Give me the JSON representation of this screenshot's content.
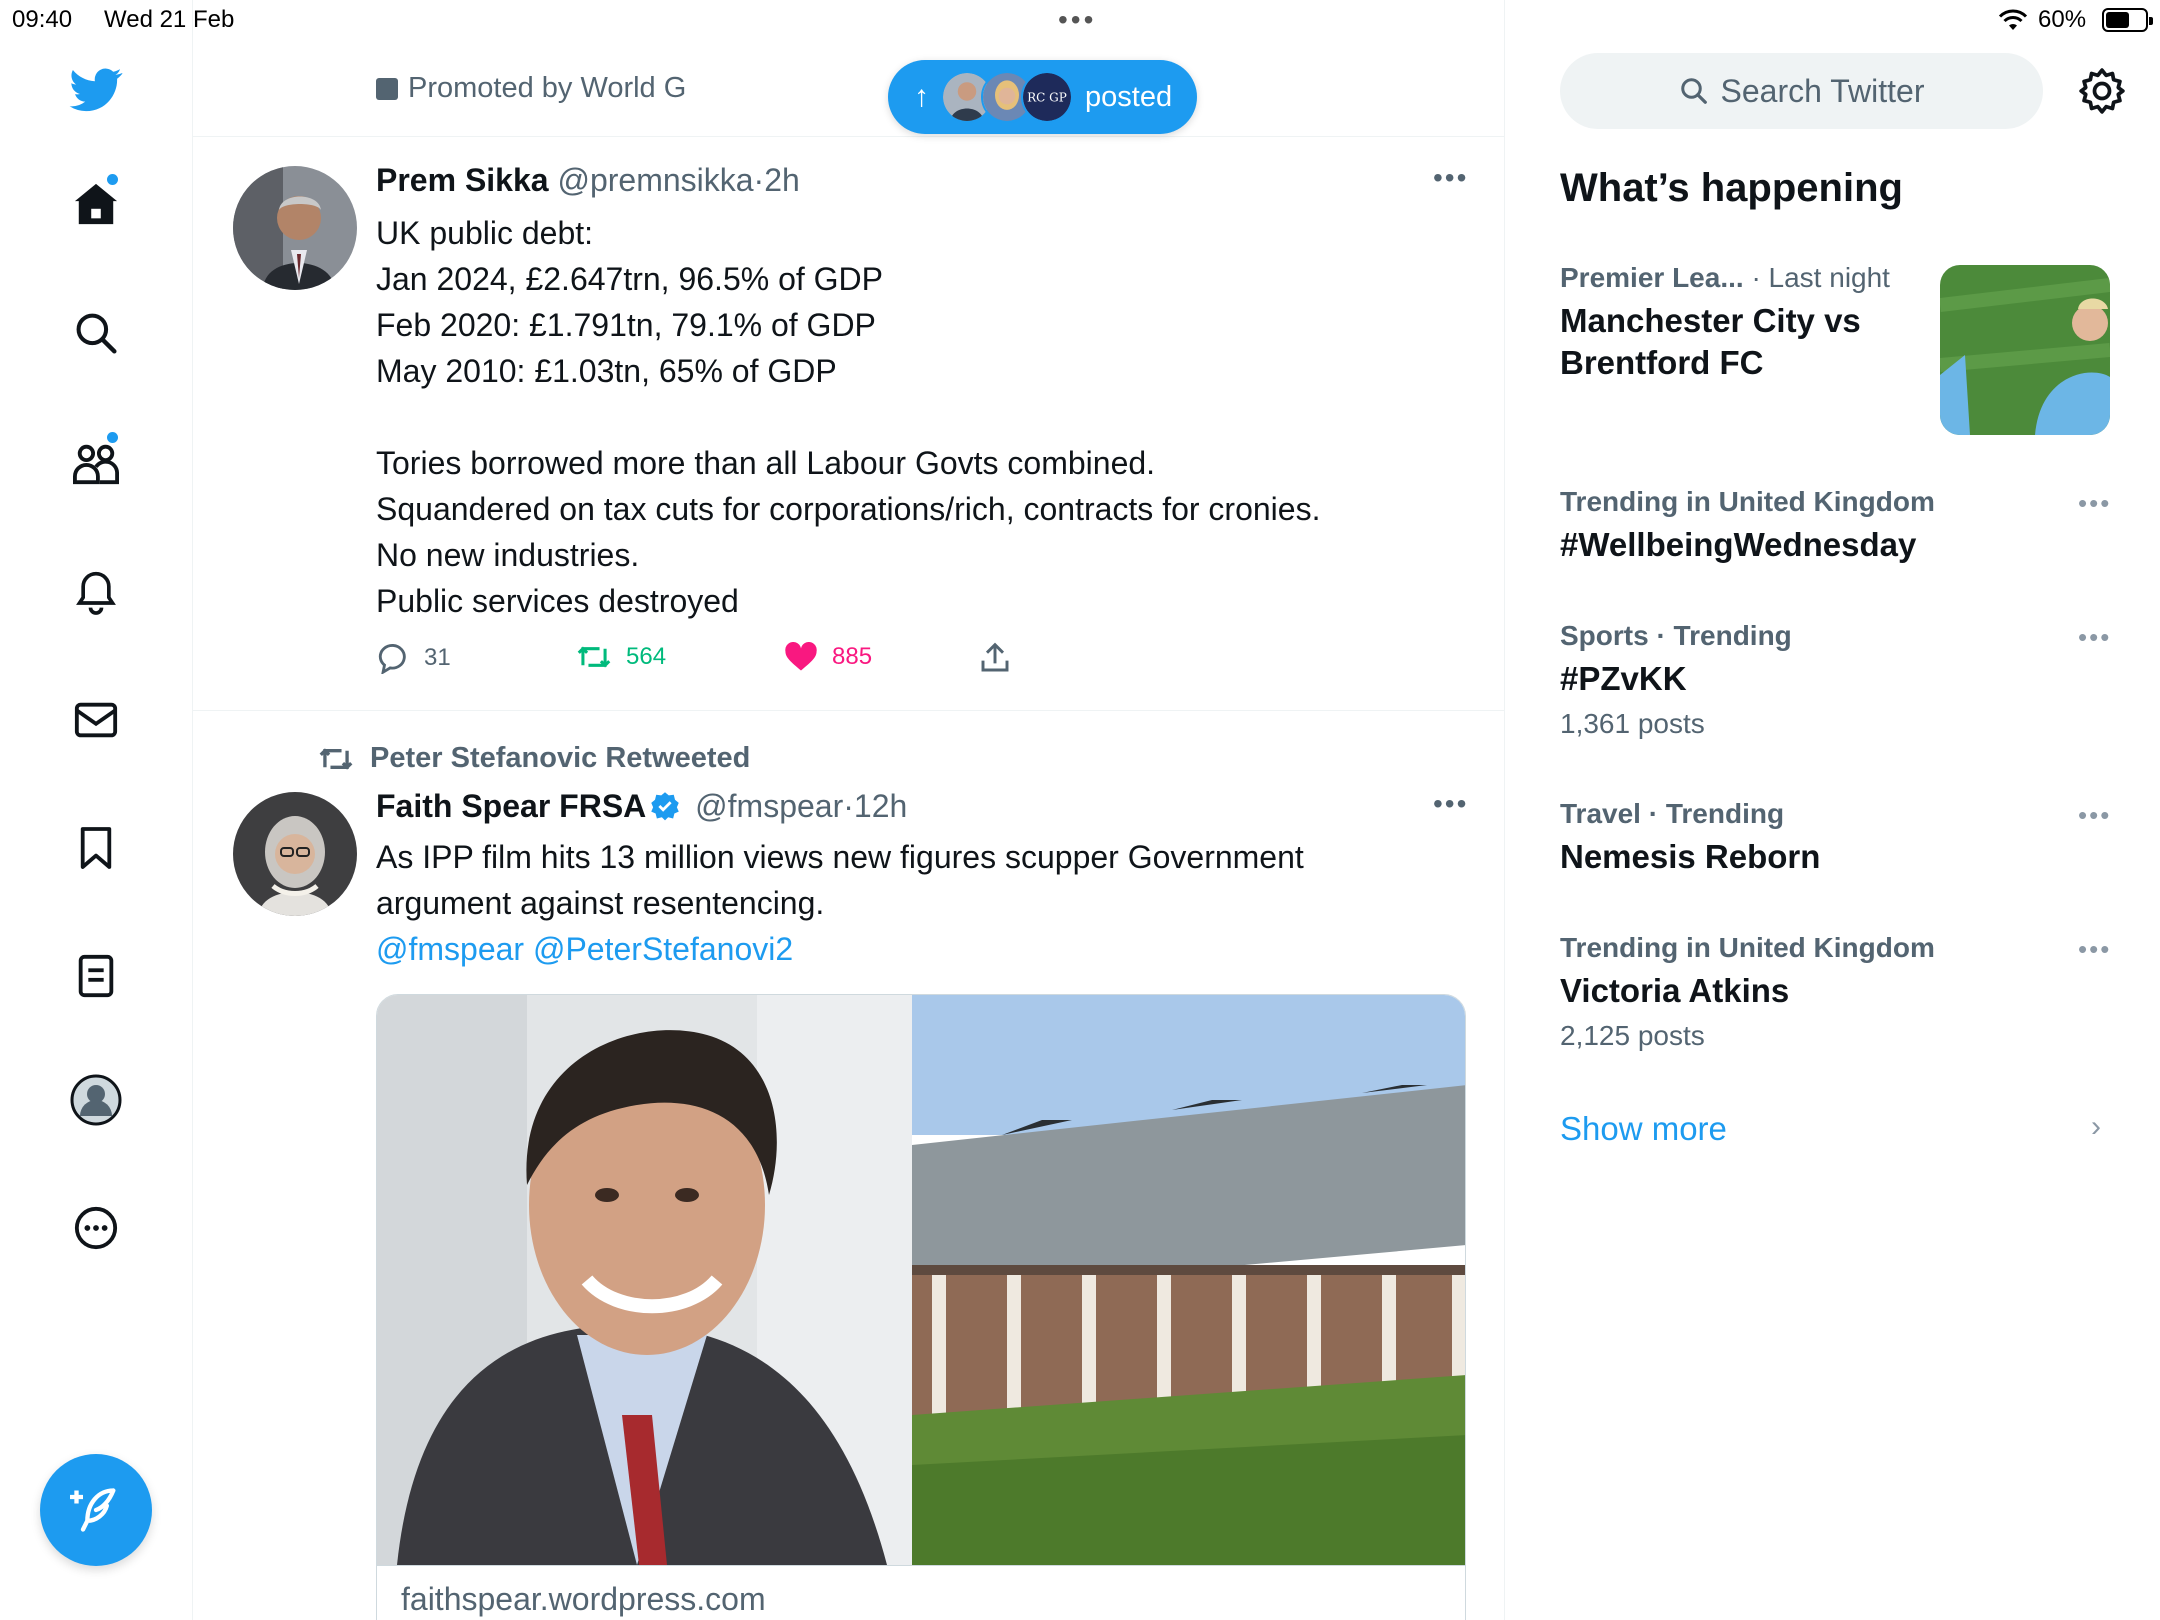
{
  "status_bar": {
    "time": "09:40",
    "date": "Wed 21 Feb",
    "battery_pct": "60%",
    "battery_level": 0.6
  },
  "promoted": {
    "text": "Promoted by World G"
  },
  "new_posts_pill": {
    "label": "posted",
    "avatar_badge": "RC GP"
  },
  "tweets": [
    {
      "name": "Prem Sikka",
      "handle": "@premnsikka",
      "time": "2h",
      "lines": [
        "UK public debt:",
        "Jan 2024, £2.647trn, 96.5% of GDP",
        "Feb 2020: £1.791tn, 79.1% of GDP",
        "May 2010: £1.03tn, 65% of GDP",
        "",
        "Tories borrowed more than all Labour Govts combined.",
        "Squandered on tax cuts for corporations/rich, contracts for cronies.",
        "No new industries.",
        "Public services destroyed"
      ],
      "replies": "31",
      "retweets": "564",
      "likes": "885"
    },
    {
      "retweeted_by": "Peter Stefanovic Retweeted",
      "name": "Faith Spear FRSA",
      "handle": "@fmspear",
      "time": "12h",
      "lines": [
        "As IPP film hits 13 million views new figures scupper Government",
        "argument against resentencing."
      ],
      "mentions": "@fmspear @PeterStefanovi2",
      "card_domain": "faithspear.wordpress.com"
    }
  ],
  "right": {
    "search_placeholder": "Search Twitter",
    "section_title": "What’s happening",
    "trends": [
      {
        "context": "Premier Lea...",
        "context2": "· Last night",
        "title": "Manchester City vs Brentford FC",
        "posts": ""
      },
      {
        "context": "Trending in United Kingdom",
        "context2": "",
        "title": "#WellbeingWednesday",
        "posts": ""
      },
      {
        "context": "Sports · Trending",
        "context2": "",
        "title": "#PZvKK",
        "posts": "1,361 posts"
      },
      {
        "context": "Travel · Trending",
        "context2": "",
        "title": "Nemesis Reborn",
        "posts": ""
      },
      {
        "context": "Trending in United Kingdom",
        "context2": "",
        "title": "Victoria Atkins",
        "posts": "2,125 posts"
      }
    ],
    "show_more": "Show more"
  },
  "colors": {
    "accent": "#1d9bf0",
    "retweet": "#00ba7c",
    "like": "#f91880",
    "secondary_text": "#536471"
  },
  "icons": [
    "twitter-logo-icon",
    "home-icon",
    "search-icon",
    "communities-icon",
    "bell-icon",
    "mail-icon",
    "bookmark-icon",
    "lists-icon",
    "profile-icon",
    "more-circle-icon",
    "compose-icon",
    "gear-icon",
    "reply-icon",
    "retweet-icon",
    "heart-icon",
    "share-icon",
    "verified-icon",
    "chevron-right-icon"
  ]
}
